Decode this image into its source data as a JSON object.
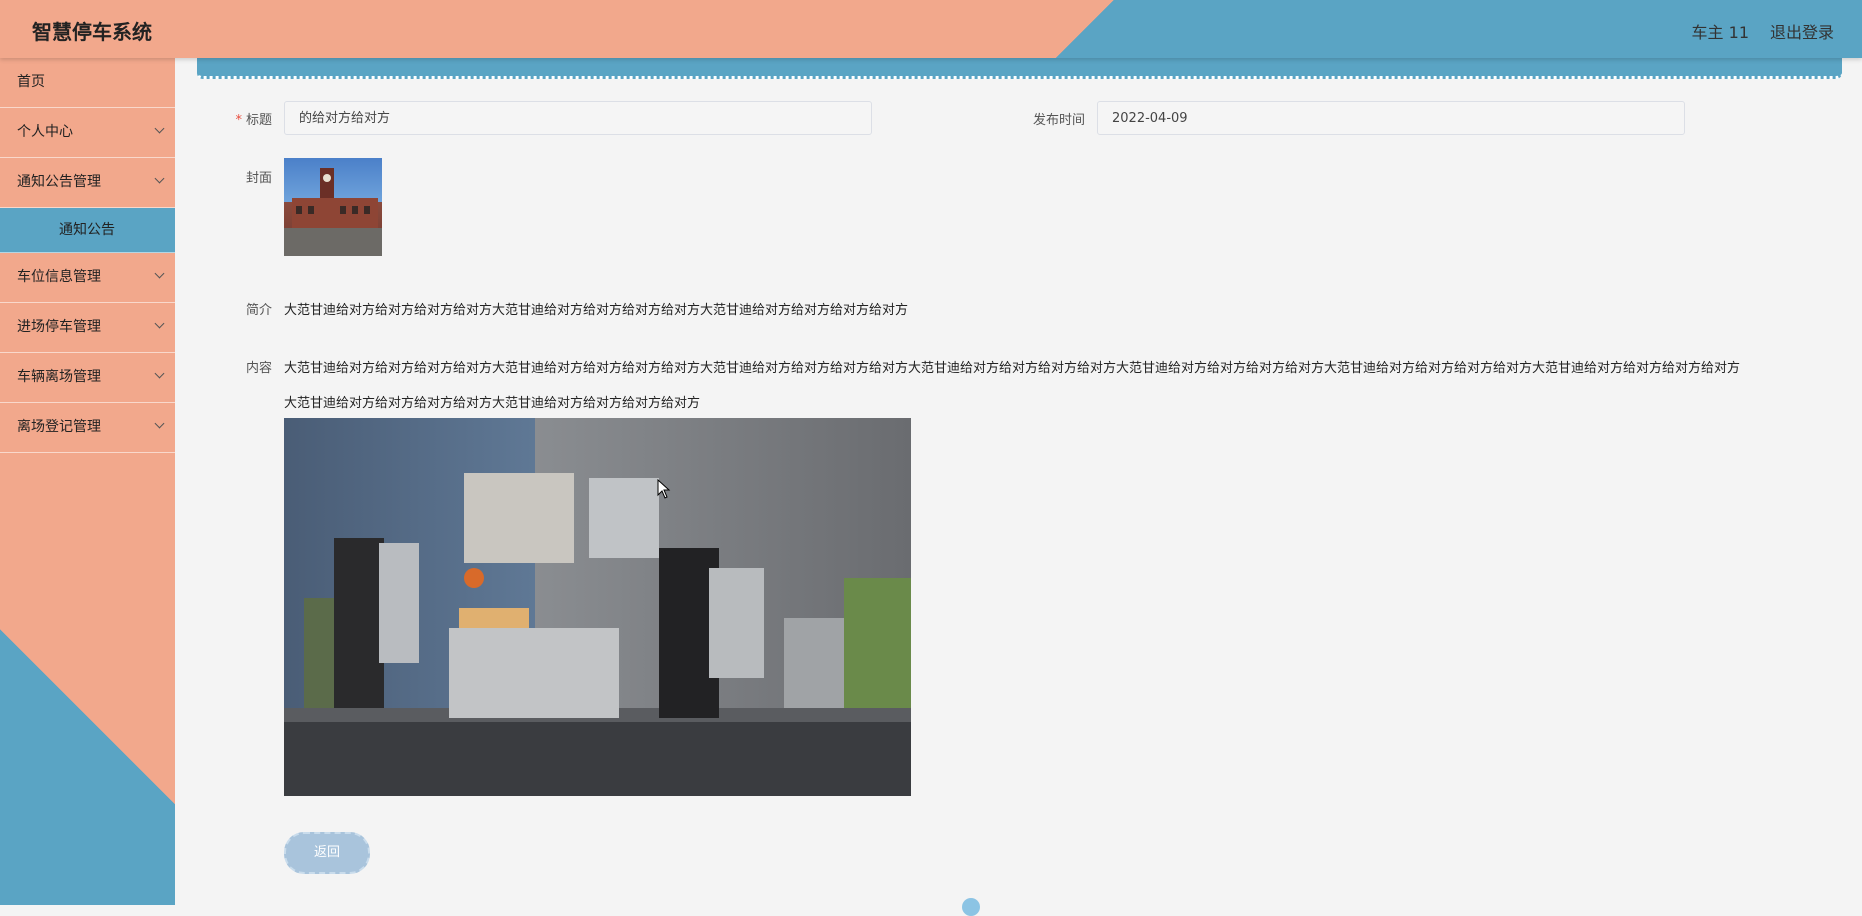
{
  "header": {
    "title": "智慧停车系统",
    "user": "车主 11",
    "logout": "退出登录"
  },
  "sidebar": {
    "items": [
      {
        "label": "首页",
        "expandable": false
      },
      {
        "label": "个人中心",
        "expandable": true
      },
      {
        "label": "通知公告管理",
        "expandable": true
      },
      {
        "label": "通知公告",
        "submenu": true
      },
      {
        "label": "车位信息管理",
        "expandable": true
      },
      {
        "label": "进场停车管理",
        "expandable": true
      },
      {
        "label": "车辆离场管理",
        "expandable": true
      },
      {
        "label": "离场登记管理",
        "expandable": true
      }
    ]
  },
  "form": {
    "title_label": "标题",
    "title_value": "的给对方给对方",
    "publish_time_label": "发布时间",
    "publish_time_value": "2022-04-09",
    "cover_label": "封面",
    "summary_label": "简介",
    "summary_value": "大范甘迪给对方给对方给对方给对方大范甘迪给对方给对方给对方给对方大范甘迪给对方给对方给对方给对方",
    "content_label": "内容",
    "content_line1": "大范甘迪给对方给对方给对方给对方大范甘迪给对方给对方给对方给对方大范甘迪给对方给对方给对方给对方大范甘迪给对方给对方给对方给对方大范甘迪给对方给对方给对方给对方大范甘迪给对方给对方给对方给对方大范甘迪给对方给对方给对方给对方",
    "content_line2": "大范甘迪给对方给对方给对方给对方大范甘迪给对方给对方给对方给对方",
    "back_button": "返回"
  },
  "colors": {
    "salmon": "#f2a88c",
    "blue": "#5aa4c4"
  }
}
